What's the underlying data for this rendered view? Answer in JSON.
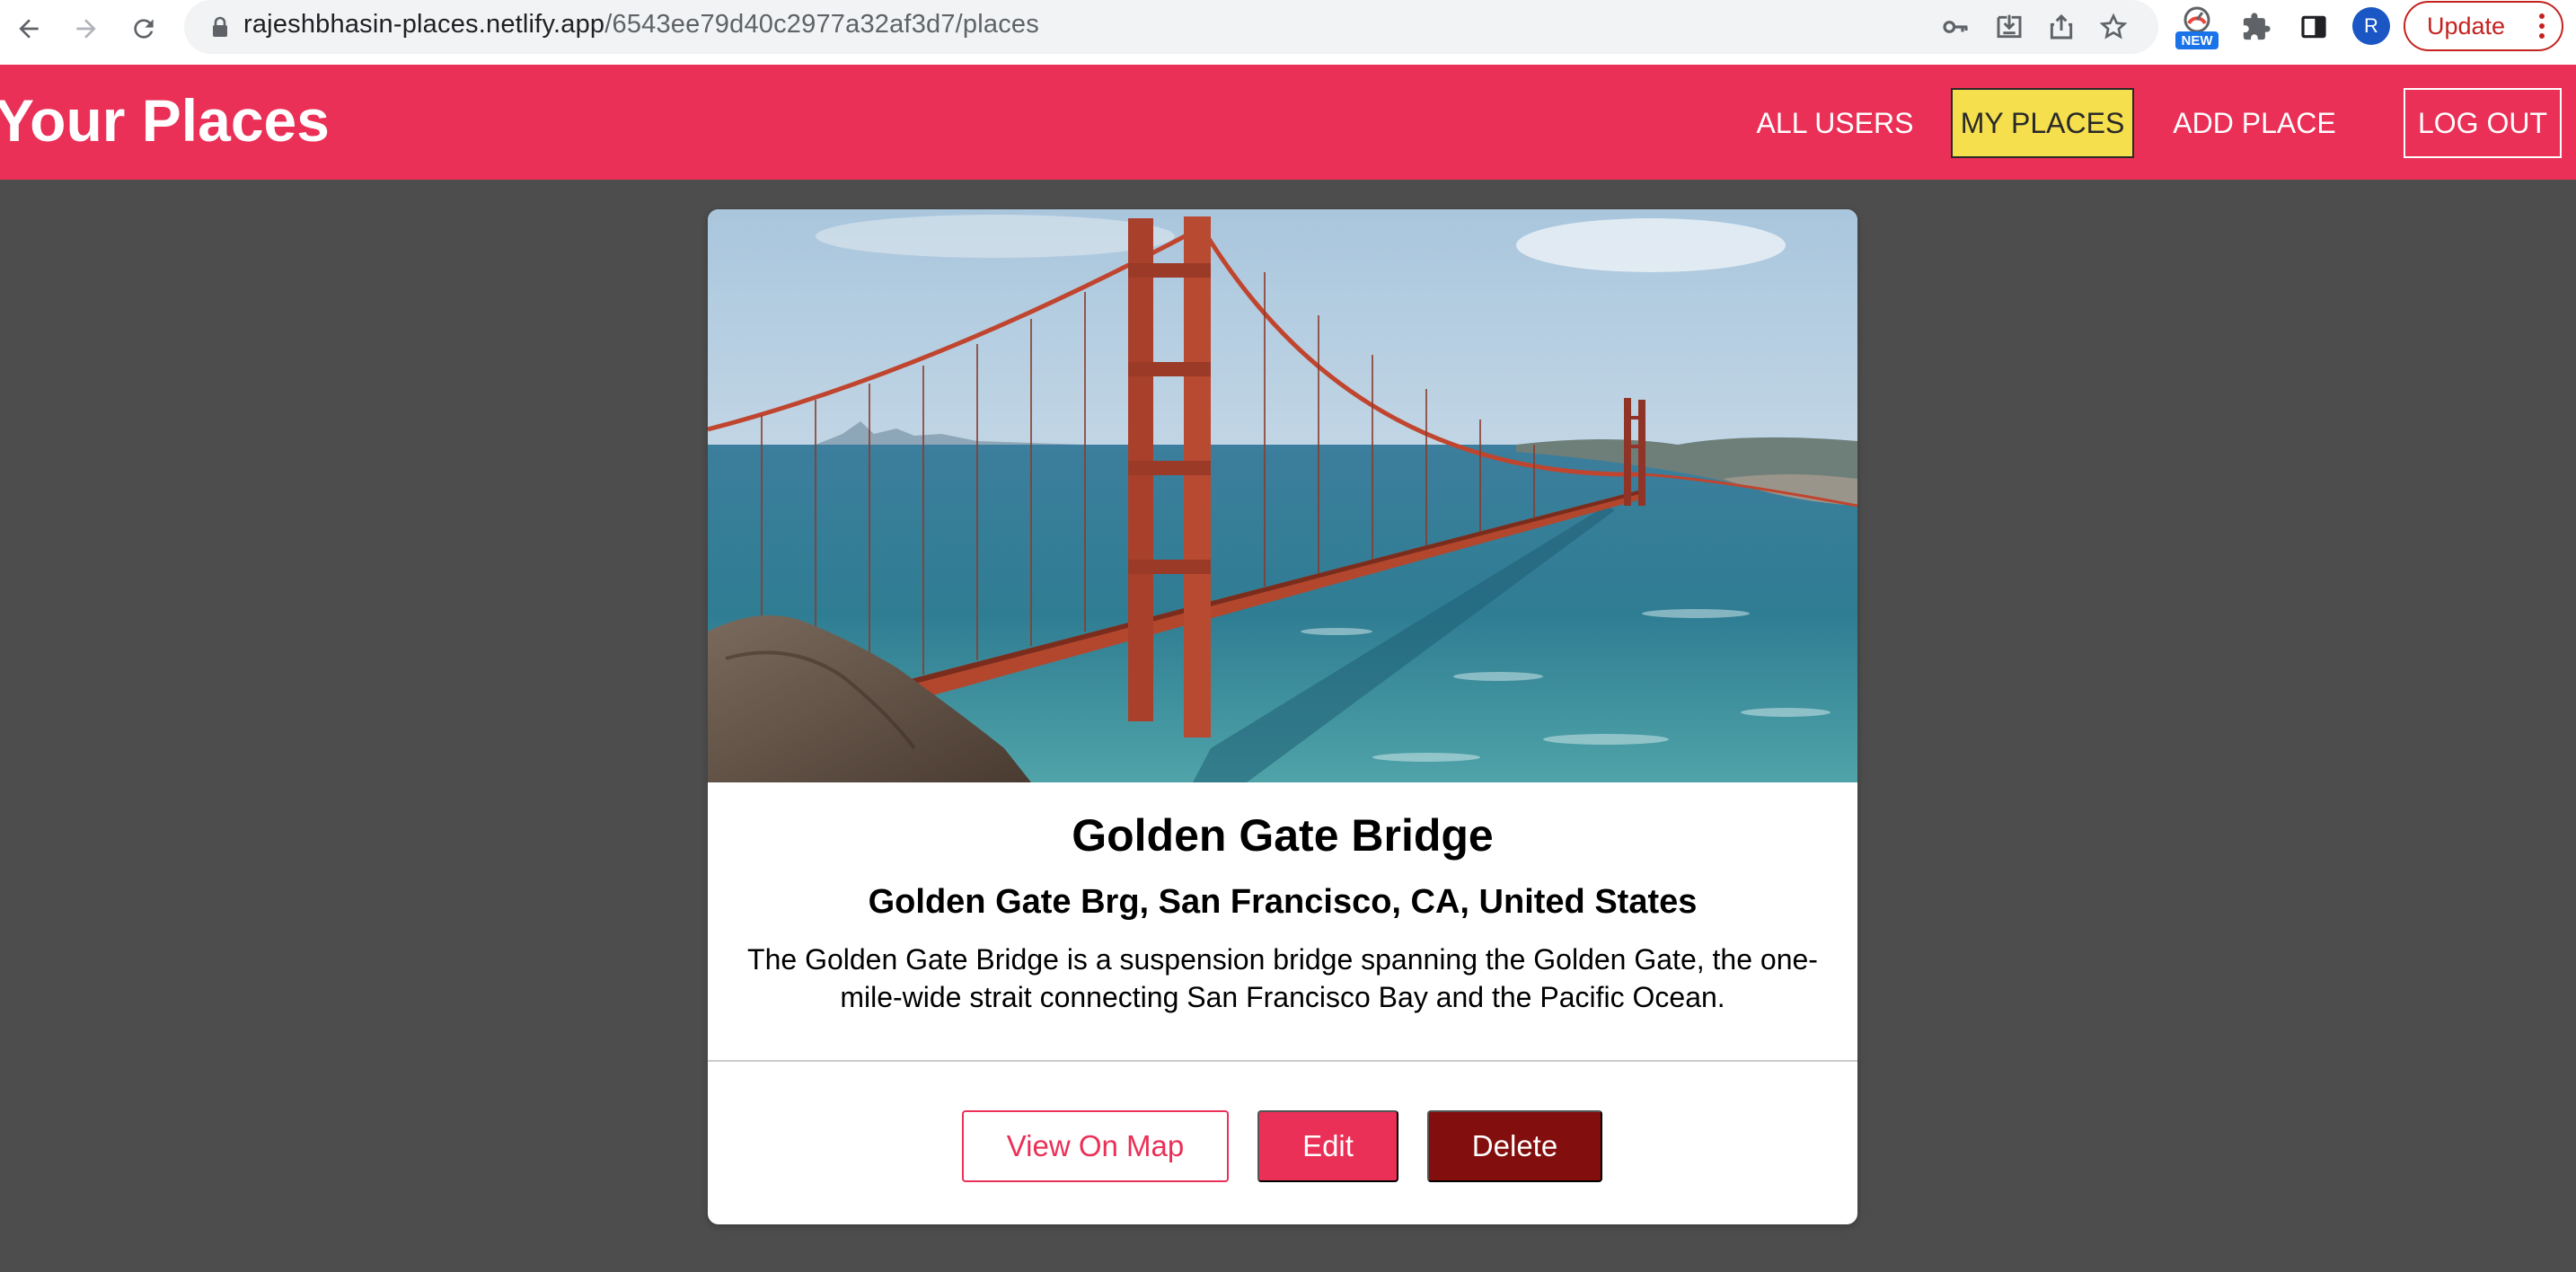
{
  "browser": {
    "url_host": "rajeshbhasin-places.netlify.app",
    "url_path": "/6543ee79d40c2977a32af3d7/places",
    "extension_badge": "NEW",
    "avatar_initial": "R",
    "update_label": "Update",
    "icons": [
      "back-icon",
      "forward-icon",
      "reload-icon",
      "lock-icon",
      "key-icon",
      "install-icon",
      "share-icon",
      "star-icon",
      "extensions-icon",
      "sidepanel-icon",
      "menu-dots-icon"
    ]
  },
  "app": {
    "brand": "Your Places",
    "nav": {
      "all_users": "ALL USERS",
      "my_places": "MY PLACES",
      "add_place": "ADD PLACE",
      "log_out": "LOG OUT"
    },
    "colors": {
      "header": "#ea3057",
      "active_nav": "#f5df4d",
      "delete": "#830e0e",
      "background": "#4d4d4d"
    }
  },
  "place": {
    "title": "Golden Gate Bridge",
    "address": "Golden Gate Brg, San Francisco, CA, United States",
    "description": "The Golden Gate Bridge is a suspension bridge spanning the Golden Gate, the one-mile-wide strait connecting San Francisco Bay and the Pacific Ocean.",
    "buttons": {
      "view_map": "View On Map",
      "edit": "Edit",
      "delete": "Delete"
    }
  }
}
